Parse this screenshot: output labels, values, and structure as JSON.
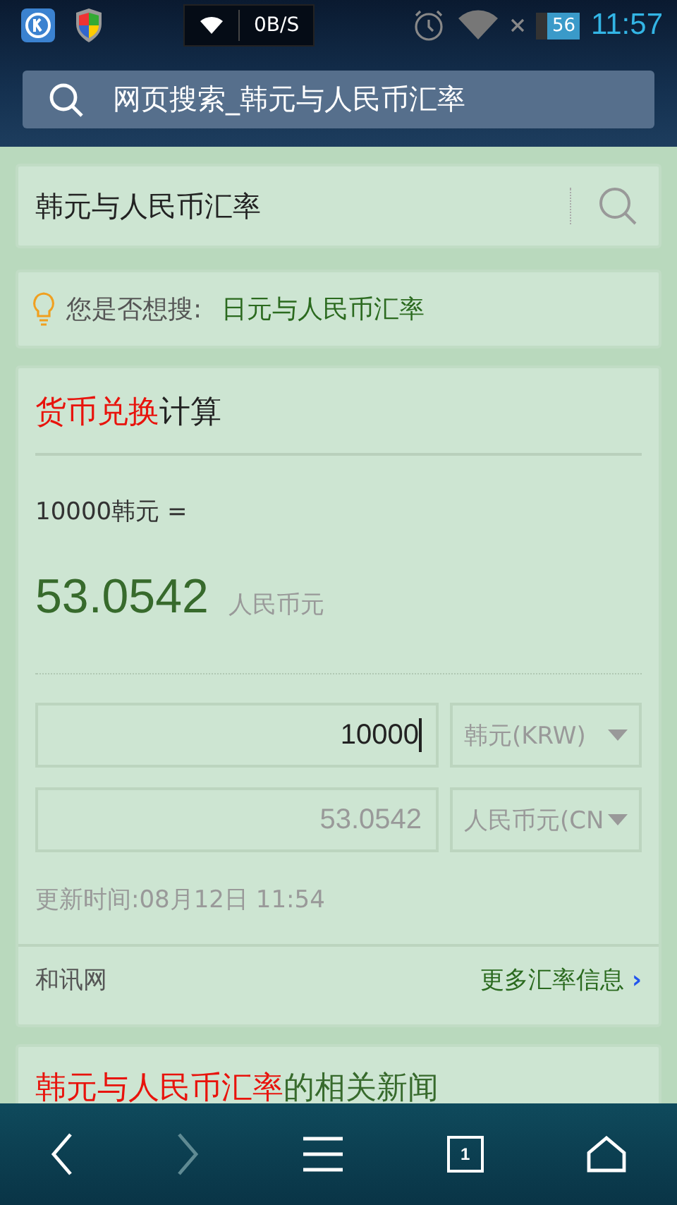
{
  "status_bar": {
    "net_speed": "0B/S",
    "battery": "56",
    "time": "11:57"
  },
  "address_bar": {
    "text": "网页搜索_韩元与人民币汇率"
  },
  "search": {
    "value": "韩元与人民币汇率"
  },
  "suggestion": {
    "label": "您是否想搜:",
    "link": "日元与人民币汇率"
  },
  "converter": {
    "title_highlight": "货币兑换",
    "title_rest": "计算",
    "source_line": "10000韩元 =",
    "result_value": "53.0542",
    "result_unit": "人民币元",
    "rows": [
      {
        "amount": "10000",
        "currency": "韩元(KRW)",
        "focused": true
      },
      {
        "amount": "53.0542",
        "currency": "人民币元(CN",
        "focused": false
      }
    ],
    "updated": "更新时间:08月12日 11:54",
    "provider": "和讯网",
    "more_link": "更多汇率信息",
    "more_arrow": "›"
  },
  "news": {
    "title_highlight": "韩元与人民币汇率",
    "title_rest": "的相关新闻"
  },
  "bottom_nav": [
    {
      "kind": "back",
      "disabled": false
    },
    {
      "kind": "forward",
      "disabled": true
    },
    {
      "kind": "menu",
      "disabled": false
    },
    {
      "kind": "tabs",
      "disabled": false,
      "count": "1"
    },
    {
      "kind": "home",
      "disabled": false
    }
  ]
}
